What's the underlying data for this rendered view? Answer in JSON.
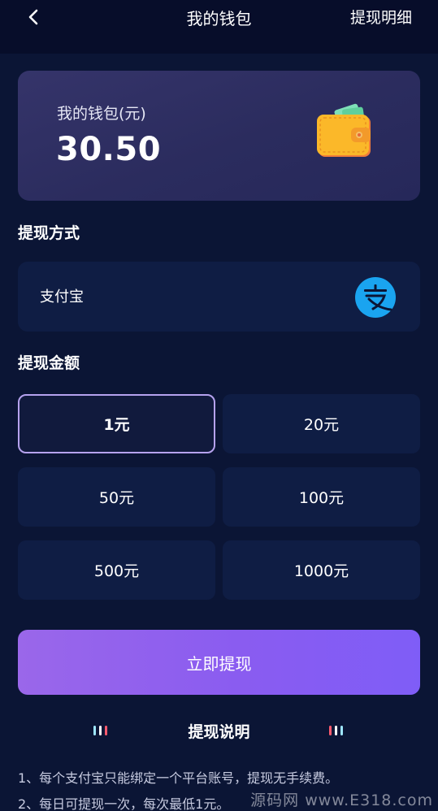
{
  "header": {
    "title": "我的钱包",
    "right_link": "提现明细"
  },
  "wallet": {
    "label": "我的钱包(元)",
    "balance": "30.50"
  },
  "withdraw_method": {
    "section_title": "提现方式",
    "method_label": "支付宝",
    "method_icon": "alipay-icon"
  },
  "withdraw_amount": {
    "section_title": "提现金额",
    "options": [
      "1元",
      "20元",
      "50元",
      "100元",
      "500元",
      "1000元"
    ],
    "selected": "1元"
  },
  "submit": {
    "label": "立即提现"
  },
  "notes": {
    "title": "提现说明",
    "lines": [
      "1、每个支付宝只能绑定一个平台账号，提现无手续费。",
      "2、每日可提现一次，每次最低1元。"
    ]
  },
  "watermark": "源码网 www.E318.com",
  "colors": {
    "background": "#0b1535",
    "card": "#0f1d44",
    "accent": "#8a5cf0",
    "selected_border": "#b5a2ee"
  }
}
